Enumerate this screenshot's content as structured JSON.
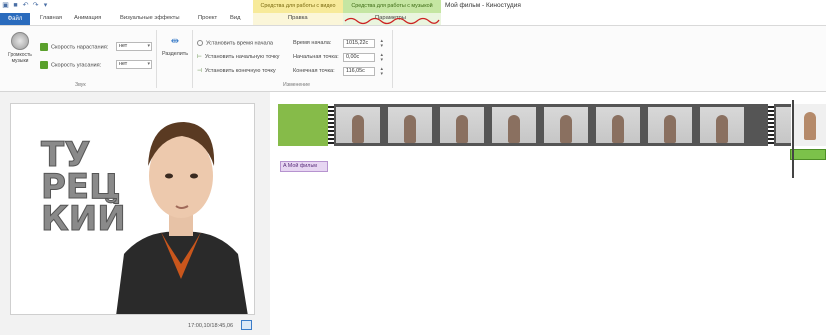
{
  "titlebar": {
    "quick_access": [
      "film-icon",
      "save-icon",
      "undo-icon",
      "redo-icon",
      "dropdown-icon"
    ],
    "context_video": "Средства для работы с видео",
    "context_music": "Средства для работы с музыкой",
    "app_title": "Мой фильм - Киностудия"
  },
  "tabs": {
    "file": "Файл",
    "home": "Главная",
    "animation": "Анимация",
    "visual_effects": "Визуальные эффекты",
    "project": "Проект",
    "view": "Вид",
    "edit_video": "Правка",
    "options_music": "Параметры"
  },
  "ribbon": {
    "music_volume": "Громкость музыки",
    "fade_in_label": "Скорость нарастания:",
    "fade_in_value": "нет",
    "fade_out_label": "Скорость угасания:",
    "fade_out_value": "нет",
    "split": "Разделить",
    "set_start_time": "Установить время начала",
    "set_start_point": "Установить начальную точку",
    "set_end_point": "Установить конечную точку",
    "start_time_label": "Время начала:",
    "start_time_value": "1015,22с",
    "start_point_label": "Начальная точка:",
    "start_point_value": "0,00с",
    "end_point_label": "Конечная точка:",
    "end_point_value": "116,05с",
    "group_sound": "Звук",
    "group_editing": "Изменение"
  },
  "preview": {
    "caption_text": "ТУ\nРЕЦ\nКИЙ",
    "timecode": "17:00,10/18:45,06"
  },
  "timeline": {
    "title_clip": "Мой фильм"
  },
  "colors": {
    "file_tab": "#2a6bbd",
    "context_video": "#f7ea9a",
    "context_music": "#c5e6a2",
    "music_bar": "#7cc24a",
    "title_clip": "#e7d6f2"
  }
}
